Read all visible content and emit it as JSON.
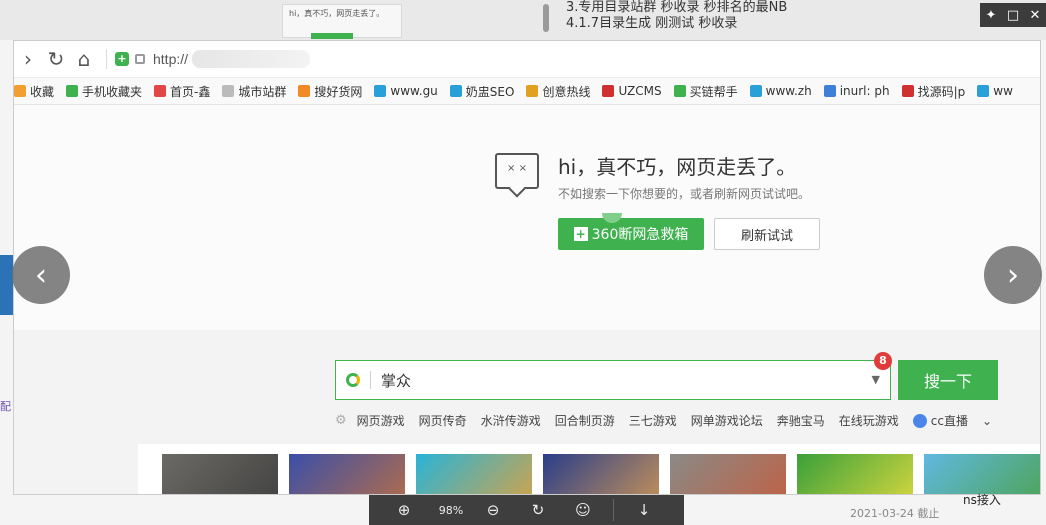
{
  "background": {
    "thumb_title": "hi，真不巧，网页走丢了。",
    "lines": [
      "3.专用目录站群  秒收录 秒排名的最NB",
      "4.1.7目录生成  刚测试      秒收录"
    ],
    "left_text": "配"
  },
  "window_controls": [
    "pin-icon",
    "maximize-icon",
    "close-icon"
  ],
  "browser": {
    "url_prefix": "http://",
    "bookmarks": [
      {
        "label": "收藏",
        "color": "#f0a030"
      },
      {
        "label": "手机收藏夹",
        "color": "#3fb24f"
      },
      {
        "label": "首页-鑫",
        "color": "#e04848"
      },
      {
        "label": "城市站群",
        "color": "#bbbbbb"
      },
      {
        "label": "搜好货网",
        "color": "#f08a24"
      },
      {
        "label": "www.gu",
        "color": "#2aa0d8"
      },
      {
        "label": "奶盅SEO",
        "color": "#2aa0d8"
      },
      {
        "label": "创意热线",
        "color": "#e0a020"
      },
      {
        "label": "UZCMS",
        "color": "#d03030"
      },
      {
        "label": "买链帮手",
        "color": "#3fb24f"
      },
      {
        "label": "www.zh",
        "color": "#2aa0d8"
      },
      {
        "label": "inurl: ph",
        "color": "#3f7fd8"
      },
      {
        "label": "找源码|p",
        "color": "#d03030"
      },
      {
        "label": "ww",
        "color": "#2aa0d8"
      }
    ]
  },
  "error_page": {
    "face": "× ×",
    "title": "hi，真不巧，网页走丢了。",
    "subtitle": "不如搜索一下你想要的，或者刷新网页试试吧。",
    "rescue_button": "360断网急救箱",
    "refresh_button": "刷新试试"
  },
  "search": {
    "value": "掌众",
    "badge": "8",
    "button": "搜一下",
    "hot_links": [
      "网页游戏",
      "网页传奇",
      "水浒传游戏",
      "回合制页游",
      "三七游戏",
      "网单游戏论坛",
      "奔驰宝马",
      "在线玩游戏",
      "cc直播"
    ]
  },
  "thumbnails": [
    {
      "colors": [
        "#6b6a66",
        "#3b3b3a"
      ]
    },
    {
      "colors": [
        "#3a4fa8",
        "#c8723a"
      ]
    },
    {
      "colors": [
        "#28b4d8",
        "#f0a030"
      ]
    },
    {
      "colors": [
        "#2a3e8a",
        "#e0a050"
      ]
    },
    {
      "colors": [
        "#8a8a86",
        "#c95a3a"
      ]
    },
    {
      "colors": [
        "#3aa03a",
        "#f0e040"
      ]
    },
    {
      "colors": [
        "#60b8e0",
        "#4aa040"
      ]
    }
  ],
  "viewer": {
    "zoom": "98%",
    "timestamp": "2021-03-24 截止",
    "extra_text": "ns接入"
  }
}
